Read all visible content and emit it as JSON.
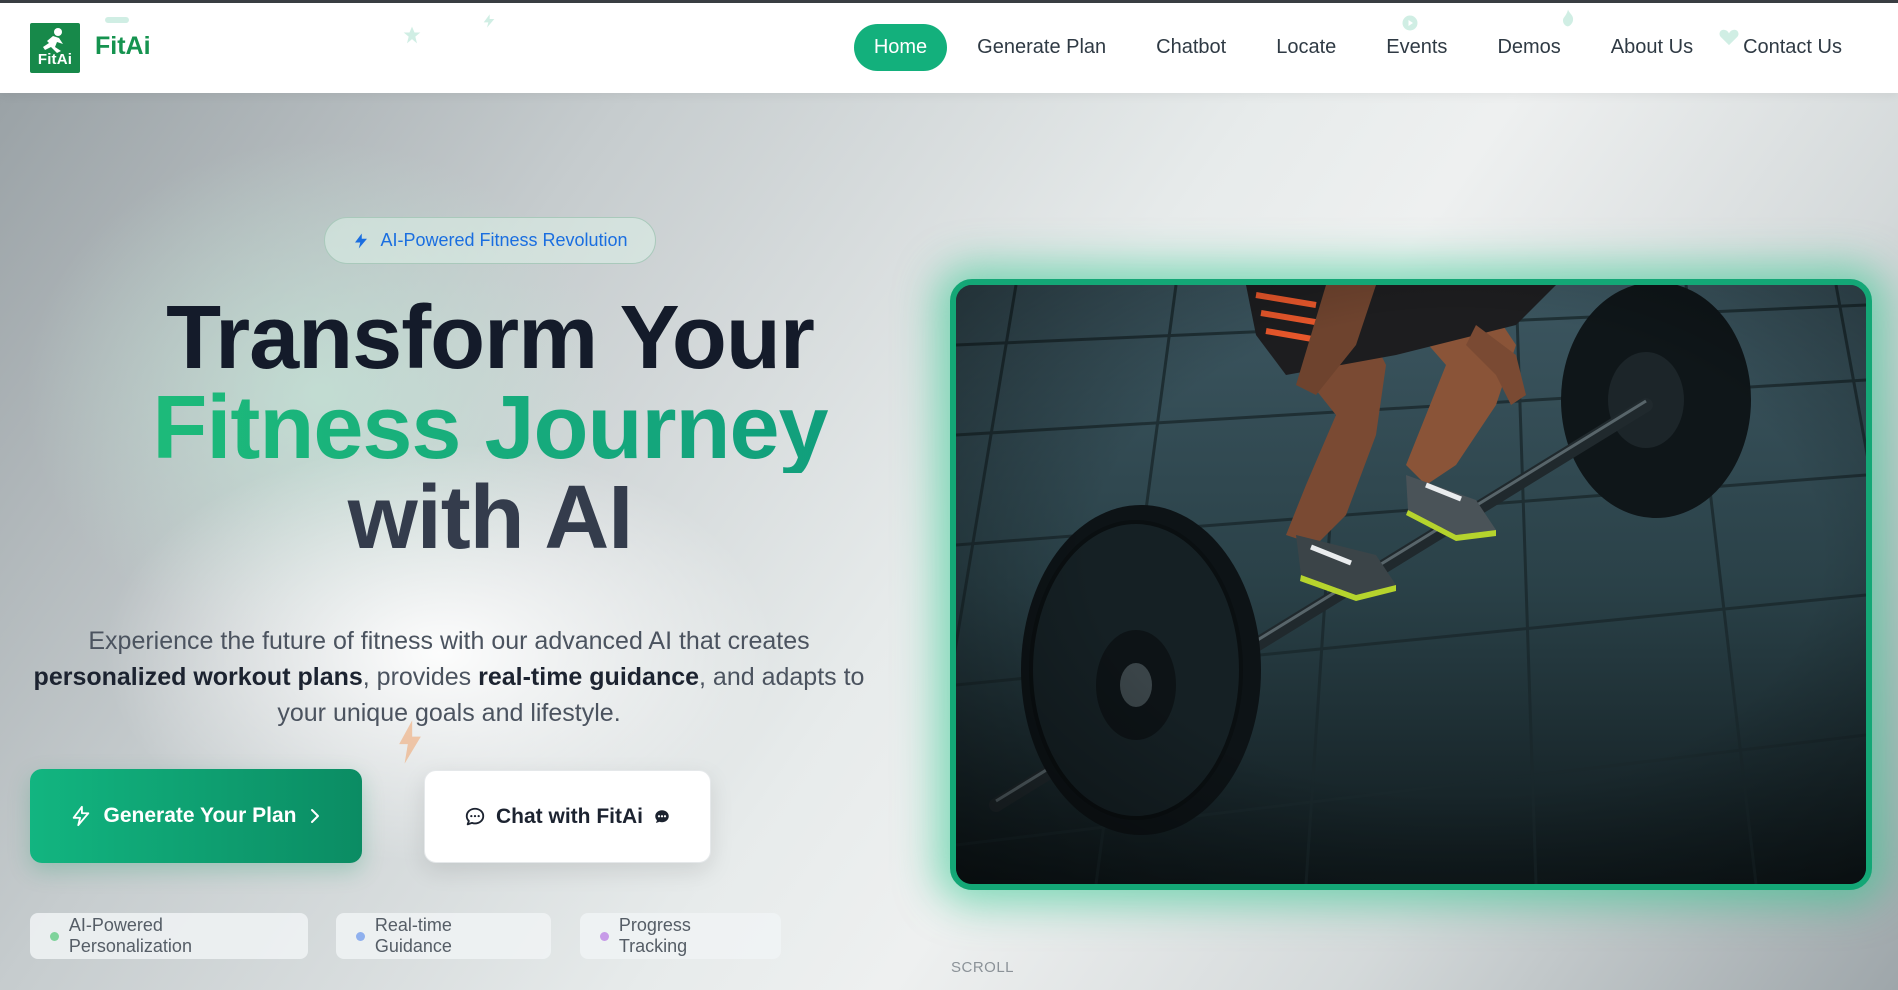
{
  "brand": {
    "logo_text": "FitAi",
    "name": "FitAi"
  },
  "nav": {
    "items": [
      {
        "label": "Home",
        "active": true
      },
      {
        "label": "Generate Plan",
        "active": false
      },
      {
        "label": "Chatbot",
        "active": false
      },
      {
        "label": "Locate",
        "active": false
      },
      {
        "label": "Events",
        "active": false
      },
      {
        "label": "Demos",
        "active": false
      },
      {
        "label": "About Us",
        "active": false
      },
      {
        "label": "Contact Us",
        "active": false
      }
    ]
  },
  "hero": {
    "badge": "AI-Powered Fitness Revolution",
    "headline_line1": "Transform Your",
    "headline_line2": "Fitness Journey",
    "headline_line3": "with AI",
    "sub_part1": "Experience the future of fitness with our advanced AI that creates ",
    "sub_bold1": "personalized workout plans",
    "sub_part2": ", provides ",
    "sub_bold2": "real-time guidance",
    "sub_part3": ", and adapts to your unique goals and lifestyle.",
    "primary_button": "Generate Your Plan",
    "secondary_button": "Chat with FitAi",
    "chips": [
      {
        "label": "AI-Powered Personalization",
        "dot_color": "#7fd39b"
      },
      {
        "label": "Real-time Guidance",
        "dot_color": "#8fb0ee"
      },
      {
        "label": "Progress Tracking",
        "dot_color": "#c79be8"
      }
    ],
    "scroll_label": "SCROLL"
  },
  "colors": {
    "brand_green": "#15934f",
    "accent": "#13b07c",
    "badge_text": "#1a6ee0"
  },
  "icons": [
    "lightning-icon",
    "chevron-right-icon",
    "chat-bubble-icon",
    "chat-dots-icon"
  ]
}
